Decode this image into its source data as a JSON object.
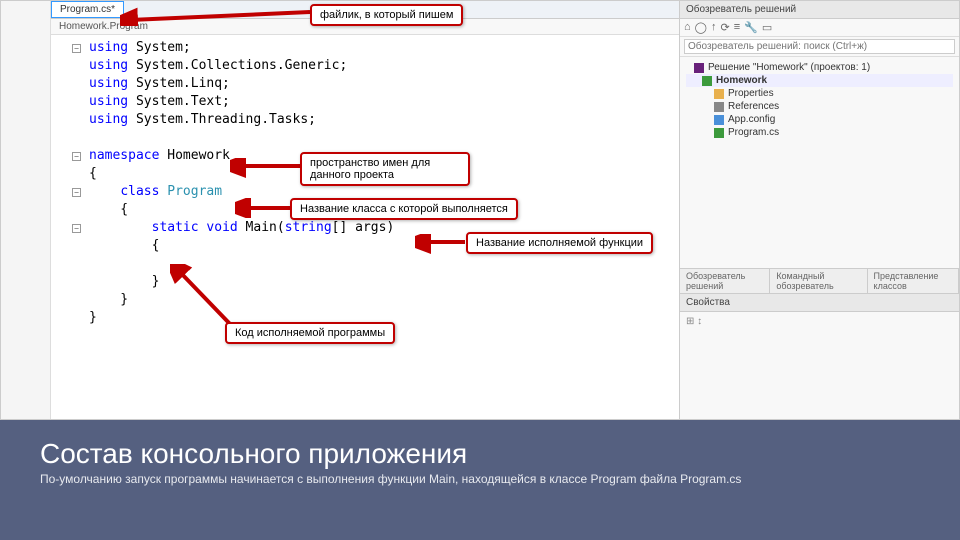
{
  "ide": {
    "tab_active": "Program.cs*",
    "subtab": "Homework.Program",
    "code_lines": [
      {
        "fold": "-",
        "html": "<span class='kw'>using</span> System;"
      },
      {
        "fold": "",
        "html": "<span class='kw'>using</span> System.Collections.Generic;"
      },
      {
        "fold": "",
        "html": "<span class='kw'>using</span> System.Linq;"
      },
      {
        "fold": "",
        "html": "<span class='kw'>using</span> System.Text;"
      },
      {
        "fold": "",
        "html": "<span class='kw'>using</span> System.Threading.Tasks;"
      },
      {
        "fold": "",
        "html": ""
      },
      {
        "fold": "-",
        "html": "<span class='kw'>namespace</span> <span class='ns'>Homework</span>"
      },
      {
        "fold": "",
        "html": "{"
      },
      {
        "fold": "-",
        "html": "    <span class='kw'>class</span> <span class='type'>Program</span>"
      },
      {
        "fold": "",
        "html": "    {"
      },
      {
        "fold": "-",
        "html": "        <span class='kw'>static</span> <span class='kw'>void</span> Main(<span class='kw'>string</span>[] args)"
      },
      {
        "fold": "",
        "html": "        {"
      },
      {
        "fold": "",
        "html": ""
      },
      {
        "fold": "",
        "html": "        }"
      },
      {
        "fold": "",
        "html": "    }"
      },
      {
        "fold": "",
        "html": "}"
      }
    ]
  },
  "solution": {
    "panel_title": "Обозреватель решений",
    "search_placeholder": "Обозреватель решений: поиск (Ctrl+ж)",
    "root": "Решение \"Homework\" (проектов: 1)",
    "project": "Homework",
    "nodes": {
      "properties": "Properties",
      "references": "References",
      "appconfig": "App.config",
      "programcs": "Program.cs"
    },
    "tab_row": [
      "Обозреватель решений",
      "Командный обозреватель",
      "Представление классов"
    ],
    "props_title": "Свойства"
  },
  "callouts": {
    "c1": "файлик, в который пишем",
    "c2": "пространство имен для данного проекта",
    "c3": "Название класса с которой выполняется",
    "c4": "Название исполняемой функции",
    "c5": "Код исполняемой программы"
  },
  "banner": {
    "title": "Состав консольного приложения",
    "subtitle": "По-умолчанию запуск программы начинается с выполнения функции Main, находящейся в классе Program файла Program.cs"
  }
}
